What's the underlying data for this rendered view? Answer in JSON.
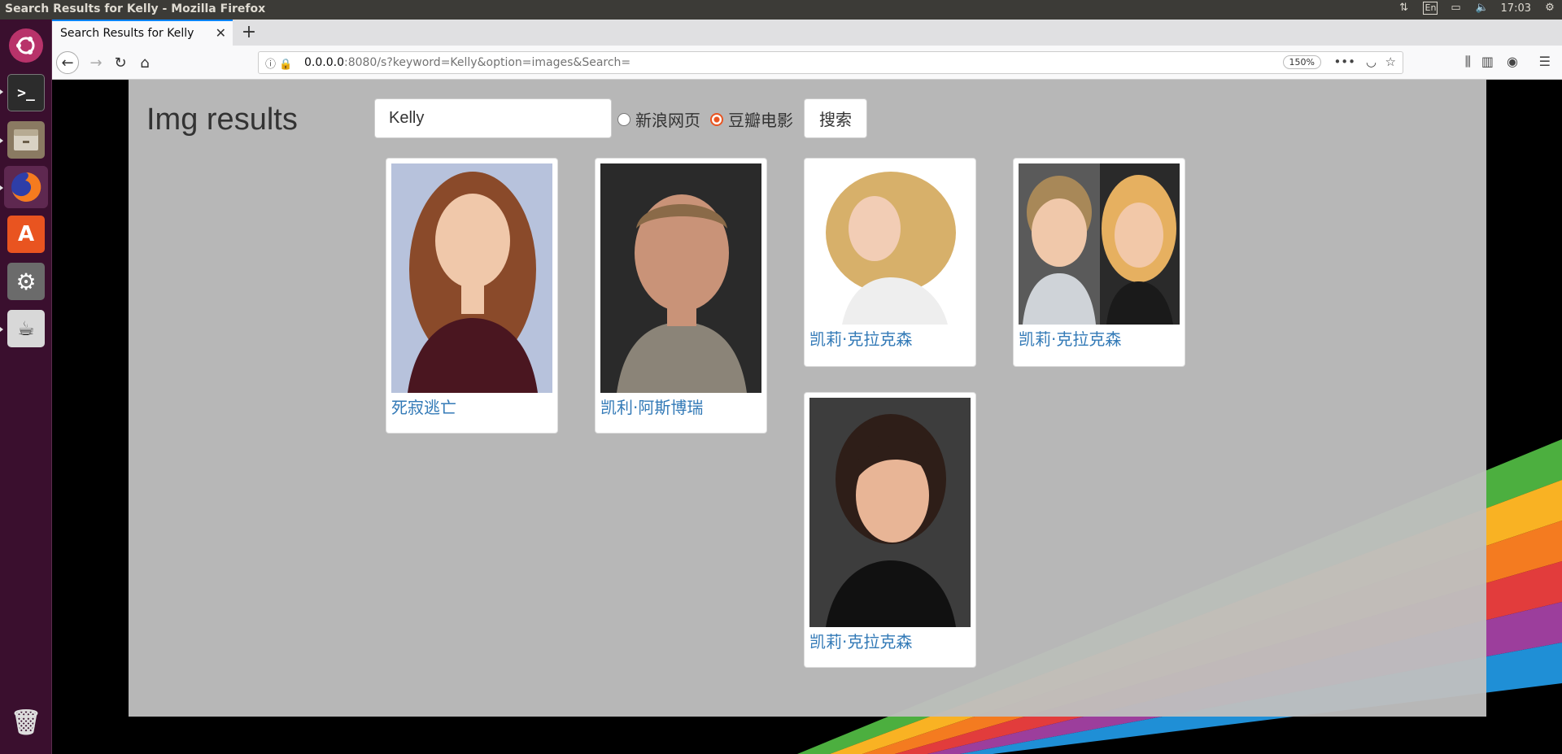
{
  "os": {
    "window_title": "Search Results for Kelly - Mozilla Firefox",
    "clock": "17:03",
    "keyboard_layout": "En"
  },
  "launcher": {
    "items": [
      {
        "name": "dash",
        "color": "#b8336a"
      },
      {
        "name": "terminal",
        "color": "#2c2c2c"
      },
      {
        "name": "files",
        "color": "#7a6a55"
      },
      {
        "name": "firefox",
        "color": "#e66000"
      },
      {
        "name": "software",
        "color": "#e95420"
      },
      {
        "name": "settings",
        "color": "#6b6b6b"
      },
      {
        "name": "java",
        "color": "#d8d8d8"
      },
      {
        "name": "trash",
        "color": "#888888"
      }
    ]
  },
  "browser": {
    "tab_title": "Search Results for Kelly",
    "url_host": "0.0.0.0",
    "url_rest": ":8080/s?keyword=Kelly&option=images&Search=",
    "zoom": "150%"
  },
  "page": {
    "heading": "Img results",
    "search_value": "Kelly",
    "options": [
      {
        "label": "新浪网页",
        "checked": false
      },
      {
        "label": "豆瓣电影",
        "checked": true
      }
    ],
    "search_button": "搜索",
    "results": [
      {
        "caption": "死寂逃亡"
      },
      {
        "caption": "凯利·阿斯博瑞"
      },
      {
        "caption": "凯莉·克拉克森"
      },
      {
        "caption": "凯莉·克拉克森"
      },
      {
        "caption": "凯莉·克拉克森"
      }
    ]
  },
  "colors": {
    "accent": "#e95420",
    "link": "#337ab7",
    "page_bg": "#bdbdbd"
  }
}
